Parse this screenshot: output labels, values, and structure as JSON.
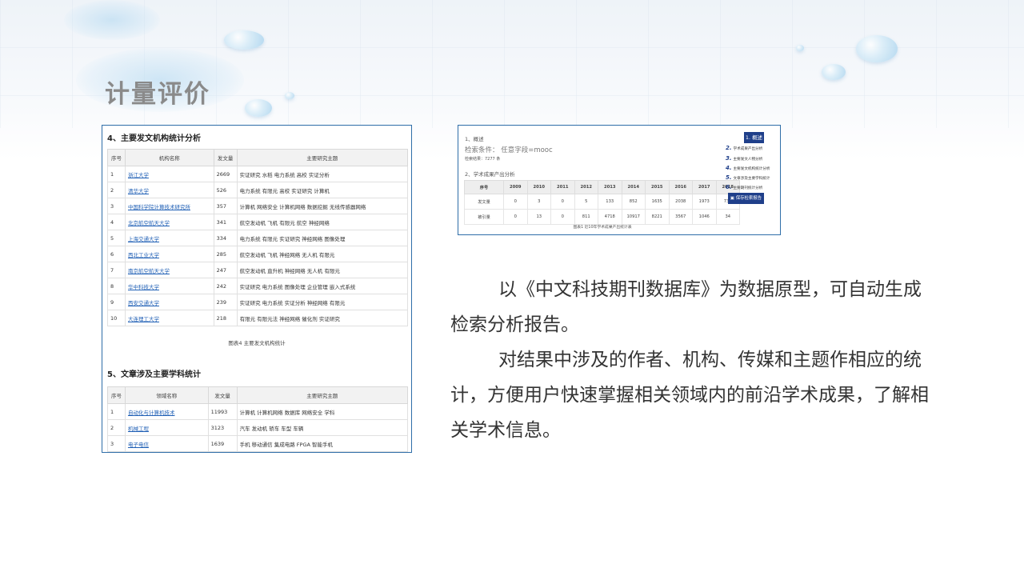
{
  "slide": {
    "title": "计量评价",
    "paragraph1": "以《中文科技期刊数据库》为数据原型，可自动生成检索分析报告。",
    "paragraph2": "对结果中涉及的作者、机构、传媒和主题作相应的统计，方便用户快速掌握相关领域内的前沿学术成果，了解相关学术信息。"
  },
  "left_panel": {
    "section4_title": "4、主要发文机构统计分析",
    "headers": [
      "序号",
      "机构名称",
      "发文量",
      "主要研究主题"
    ],
    "rows": [
      [
        "1",
        "浙江大学",
        "2669",
        "实证研究  水稻  电力系统  高校  实证分析"
      ],
      [
        "2",
        "清华大学",
        "526",
        "电力系统  有限元  高校  实证研究  计算机"
      ],
      [
        "3",
        "中国科学院计算技术研究所",
        "357",
        "计算机  网络安全  计算机网络  数据挖掘  无线传感器网络"
      ],
      [
        "4",
        "北京航空航天大学",
        "341",
        "航空发动机  飞机  有限元  航空  神经网络"
      ],
      [
        "5",
        "上海交通大学",
        "334",
        "电力系统  有限元  实证研究  神经网络  图像处理"
      ],
      [
        "6",
        "西北工业大学",
        "285",
        "航空发动机  飞机  神经网络  无人机  有限元"
      ],
      [
        "7",
        "南京航空航天大学",
        "247",
        "航空发动机  直升机  神经网络  无人机  有限元"
      ],
      [
        "8",
        "华中科技大学",
        "242",
        "实证研究  电力系统  图像处理  企业管理  嵌入式系统"
      ],
      [
        "9",
        "西安交通大学",
        "239",
        "实证研究  电力系统  实证分析  神经网络  有限元"
      ],
      [
        "10",
        "大连理工大学",
        "218",
        "有限元  有限元法  神经网络  催化剂  实证研究"
      ]
    ],
    "caption4": "图表4 主要发文机构统计",
    "section5_title": "5、文章涉及主要学科统计",
    "headers5": [
      "序号",
      "领域名称",
      "发文量",
      "主要研究主题"
    ],
    "rows5": [
      [
        "1",
        "自动化与计算机技术",
        "11993",
        "计算机  计算机网络  数据库  网络安全  学科"
      ],
      [
        "2",
        "机械工程",
        "3123",
        "汽车  发动机  轿车  车型  车辆"
      ],
      [
        "3",
        "电子电信",
        "1639",
        "手机  移动通信  集成电路  FPGA  智能手机"
      ]
    ]
  },
  "right_panel": {
    "overview": "1、概述",
    "condition": "检索条件：  任意字段=mooc",
    "result_count": "检索结果：7277 条",
    "section2": "2、学术成果产出分析",
    "year_headers": [
      "序号",
      "2009",
      "2010",
      "2011",
      "2012",
      "2013",
      "2014",
      "2015",
      "2016",
      "2017",
      "2018"
    ],
    "rows": [
      [
        "发文量",
        "0",
        "3",
        "0",
        "5",
        "133",
        "852",
        "1635",
        "2038",
        "1973",
        "738"
      ],
      [
        "被引量",
        "0",
        "13",
        "0",
        "811",
        "4718",
        "10917",
        "8221",
        "3567",
        "1046",
        "34"
      ]
    ],
    "nav_badge": "1. 概述",
    "nav_items": [
      {
        "num": "2.",
        "label": "学术成果产出分析"
      },
      {
        "num": "3.",
        "label": "主要发文人物分析"
      },
      {
        "num": "4.",
        "label": "主要发文机构统计分析"
      },
      {
        "num": "5.",
        "label": "文章涉及主要学科统计"
      },
      {
        "num": "6.",
        "label": "主要期刊统计分析"
      }
    ],
    "save_button": "保存检索报告",
    "figure_caption": "图表1 近10年学术成果产出统计表"
  }
}
